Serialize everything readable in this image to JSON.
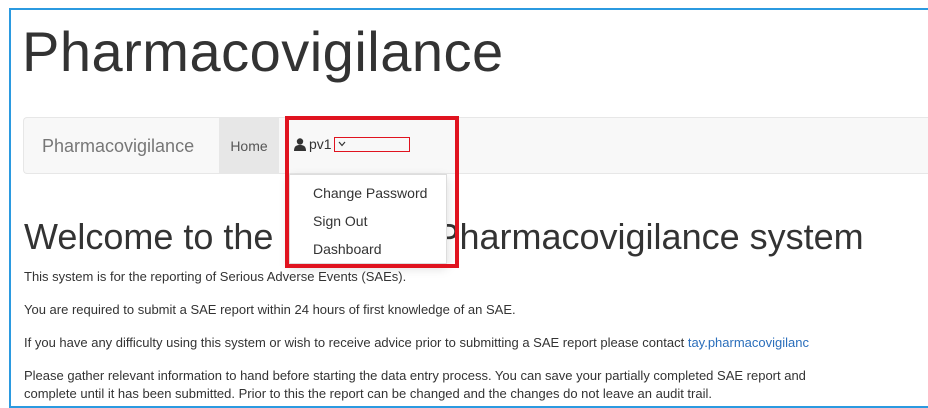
{
  "site": {
    "title": "Pharmacovigilance"
  },
  "navbar": {
    "brand": "Pharmacovigilance",
    "home": "Home",
    "user": "pv1"
  },
  "dropdown": {
    "items": [
      "Change Password",
      "Sign Out",
      "Dashboard"
    ]
  },
  "main": {
    "welcome_left": "Welcome to the",
    "welcome_right": "Pharmacovigilance system",
    "p1": "This system is for the reporting of Serious Adverse Events (SAEs).",
    "p2": "You are required to submit a SAE report within 24 hours of first knowledge of an SAE.",
    "p3": "If you have any difficulty using this system or wish to receive advice prior to submitting a SAE report please contact",
    "p3_link": "tay.pharmacovigilanc",
    "p4_line1": "Please gather relevant information to hand before starting the data entry process. You can save your partially completed SAE report and",
    "p4_line2": "complete until it has been submitted. Prior to this the report can be changed and the changes do not leave an audit trail."
  },
  "colors": {
    "highlight": "#e0131f",
    "frame": "#2b9ae0",
    "link": "#2a6ebb"
  }
}
